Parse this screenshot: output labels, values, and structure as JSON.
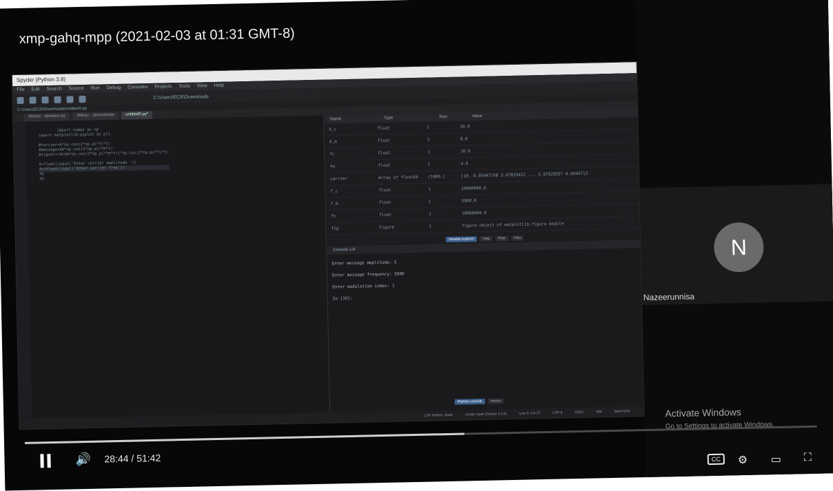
{
  "player": {
    "title": "xmp-gahq-mpp (2021-02-03 at 01:31 GMT-8)",
    "time": "28:44 / 51:42",
    "progress": 0.555
  },
  "spyder": {
    "window_title": "Spyder (Python 3.8)",
    "menu": [
      "File",
      "Edit",
      "Search",
      "Source",
      "Run",
      "Debug",
      "Consoles",
      "Projects",
      "Tools",
      "View",
      "Help"
    ],
    "path": "C:\\Users\\ECE\\Downloads",
    "editor_path": "C:\\Users\\ECE\\Downloads\\untitled0.py",
    "tabs": [
      "AMcpc - dpsktest.py",
      "AMcpc - demodulate",
      "untitled0.py*"
    ],
    "code": [
      "import numpy as np",
      "import matplotlib.pyplot as plt",
      "",
      "#carrier=A*np.cos(2*np.pi*fc*t)",
      "#message=Am*np.cos(2*np.pi*fm*t)",
      "#signal=(A+Am*np.cos(2*np.pi*fm*t))*np.cos(2*np.pi*fc*t)",
      "",
      "A=float(input('Enter carrier amplitude '))",
      "fc=float(input('Enter carrier freq'))",
      "fm",
      "fm"
    ],
    "var_headers": [
      "Name",
      "Type",
      "Size",
      "Value"
    ],
    "variables": [
      [
        "A_c",
        "float",
        "1",
        "10.0"
      ],
      [
        "A_m",
        "float",
        "1",
        "8.0"
      ],
      [
        "fc",
        "float",
        "1",
        "10.0"
      ],
      [
        "fm",
        "float",
        "1",
        "4.0"
      ],
      [
        "carrier",
        "Array of float64",
        "(1000,)",
        "[10. 0.05047168 3.07829422 ... 3.07829357 0.0694713"
      ],
      [
        "f_c",
        "float",
        "1",
        "10000000.0"
      ],
      [
        "f_m",
        "float",
        "1",
        "5000.0"
      ],
      [
        "fs",
        "float",
        "1",
        "10000000.0"
      ],
      [
        "fig",
        "Figure",
        "1",
        "Figure object of matplotlib.figure module"
      ]
    ],
    "var_tabs": [
      "Variable explorer",
      "Help",
      "Plots",
      "Files"
    ],
    "console_tab": "Console 1/A",
    "console_lines": [
      "Enter message amplitude: 5",
      "Enter message frequency: 5000",
      "Enter modulation index: 1",
      "In [16]:"
    ],
    "console_tabs": [
      "IPython console",
      "History"
    ],
    "status": [
      "LSP Python: ready",
      "conda: base (Python 3.8.5)",
      "Line 9, Col 37",
      "UTF-8",
      "CRLF",
      "RW",
      "Mem 52%"
    ]
  },
  "participant": {
    "initial": "N",
    "name": "Nazeerunnisa"
  },
  "watermark": {
    "title": "Activate Windows",
    "subtitle": "Go to Settings to activate Windows."
  },
  "colors": {
    "accent": "#3b5f8a",
    "avatar": "#6a6a6a"
  }
}
